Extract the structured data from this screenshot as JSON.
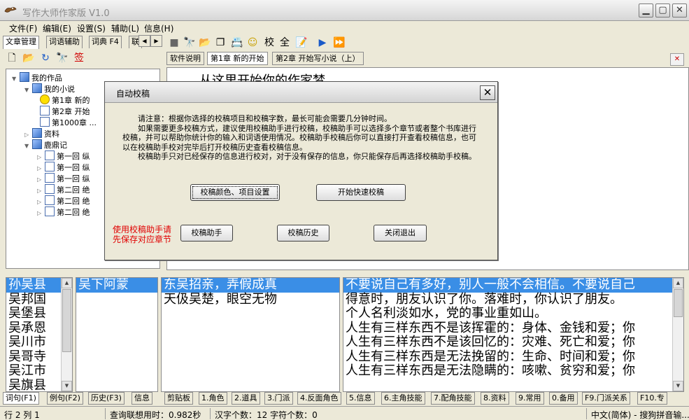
{
  "window": {
    "title": "写作大师作家版  V1.0",
    "min": "▁",
    "max": "▢",
    "close": "✕"
  },
  "menu": [
    "文件(F)",
    "编辑(E)",
    "设置(S)",
    "辅助(L)",
    "信息(H)"
  ],
  "left_tabs": [
    "文章管理",
    "词语辅助",
    "词典 F4",
    "联"
  ],
  "left_toolbar_icons": [
    "new-file-icon",
    "open-folder-icon",
    "refresh-icon",
    "binoculars-icon",
    "sign-icon"
  ],
  "left_toolbar_glyphs": [
    "🗋",
    "📂",
    "↻",
    "🔭",
    "签"
  ],
  "tree": {
    "root": "我的作品",
    "novel": "我的小说",
    "novel_items": [
      "第1章 新的",
      "第2章 开始",
      "第1000章 ..."
    ],
    "materials": "资料",
    "ludingji": "鹿鼎记",
    "ludingji_items": [
      "第一回  纵",
      "第一回  纵",
      "第一回  纵",
      "第二回  绝",
      "第二回  绝",
      "第二回  绝"
    ]
  },
  "main_toolbar_glyphs": [
    "■",
    "🔭",
    "📂",
    "❐",
    "📇",
    "☺",
    "校",
    "全",
    "📝",
    "▶",
    "⏩"
  ],
  "main_toolbar_icons": [
    "stop-icon",
    "binoculars-icon",
    "open-folder-icon",
    "document-icon",
    "list-icon",
    "smiley-icon",
    "proof-icon",
    "full-icon",
    "note-icon",
    "play-icon",
    "forward-icon"
  ],
  "doc_tabs": [
    "软件说明",
    "第1章  新的开始",
    "第2章  开始写小说（上）"
  ],
  "editor_heading": "从这里开始你的作家梦……",
  "dialog": {
    "title": "自动校稿",
    "close": "✕",
    "note1": "请注意：根据你选择的校稿项目和校稿字数，最长可能会需要几分钟时间。",
    "note2": "如果需要更多校稿方式，建议使用校稿助手进行校稿，校稿助手可以选择多个章节或者整个书库进行校稿，并可以帮助你统计你的输入和词语使用情况。校稿助手校稿后你可以直接打开查看校稿信息，也可以在校稿助手校对完毕后打开校稿历史查看校稿信息。",
    "note3": "校稿助手只对已经保存的信息进行校对，对于没有保存的信息，你只能保存后再选择校稿助手校稿。",
    "btn_settings": "校稿颜色、项目设置",
    "btn_quick": "开始快速校稿",
    "warn_line1": "使用校稿助手请",
    "warn_line2": "先保存对应章节",
    "btn_assistant": "校稿助手",
    "btn_history": "校稿历史",
    "btn_exit": "关闭退出"
  },
  "list1": [
    "孙吴县",
    "吴邦国",
    "吴堡县",
    "吴承恩",
    "吴川市",
    "吴哥寺",
    "吴江市",
    "吴旗县"
  ],
  "list2": [
    "吴下阿蒙"
  ],
  "list3": [
    "东吴招亲，弄假成真",
    "天伋吴楚，眼空无物"
  ],
  "list4": [
    "不要说自己有多好，别人一般不会相信。不要说自己",
    "得意时，朋友认识了你。落难时，你认识了朋友。",
    "个人名利淡如水，党的事业重如山。",
    "人生有三样东西不是该挥霍的：身体、金钱和爱；你",
    "人生有三样东西不是该回忆的：灾难、死亡和爱；你",
    "人生有三样东西是无法挽留的：生命、时间和爱；你",
    "人生有三样东西是无法隐瞒的：咳嗽、贫穷和爱；你"
  ],
  "bottom_tabs": [
    "词句(F1)",
    "例句(F2)",
    "历史(F3)",
    "信息",
    "剪贴板",
    "1.角色",
    "2.道具",
    "3.门派",
    "4.反面角色",
    "5.信息",
    "6.主角技能",
    "7.配角技能",
    "8.资料",
    "9.常用",
    "0.备用",
    "F9.门派关系",
    "F10.专"
  ],
  "status": {
    "position": "行 2  列 1",
    "query_time": "查询联想用时：0.982秒",
    "counts": "汉字个数：12 字符个数：0",
    "ime": "中文(简体) - 搜狗拼音输..."
  }
}
